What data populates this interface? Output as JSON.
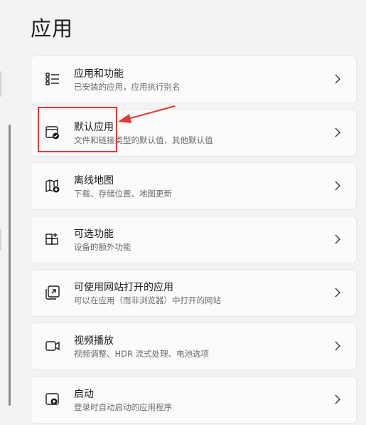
{
  "page": {
    "title": "应用"
  },
  "cards": [
    {
      "icon": "apps-list-icon",
      "title": "应用和功能",
      "subtitle": "已安装的应用，应用执行别名"
    },
    {
      "icon": "default-apps-icon",
      "title": "默认应用",
      "subtitle": "文件和链接类型的默认值，其他默认值"
    },
    {
      "icon": "offline-maps-icon",
      "title": "离线地图",
      "subtitle": "下载、存储位置、地图更新"
    },
    {
      "icon": "optional-features-icon",
      "title": "可选功能",
      "subtitle": "设备的额外功能"
    },
    {
      "icon": "apps-for-websites-icon",
      "title": "可使用网站打开的应用",
      "subtitle": "可以在应用（而非浏览器）中打开的网站"
    },
    {
      "icon": "video-playback-icon",
      "title": "视频播放",
      "subtitle": "视频调整、HDR 流式处理、电池选项"
    },
    {
      "icon": "startup-icon",
      "title": "启动",
      "subtitle": "登录时自动启动的应用程序"
    }
  ],
  "annotation": {
    "color": "#e53935"
  }
}
